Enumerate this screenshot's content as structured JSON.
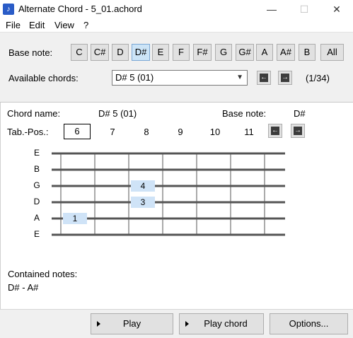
{
  "window": {
    "title": "Alternate Chord - 5_01.achord",
    "minimize": "—",
    "maximize": "☐",
    "close": "✕"
  },
  "menu": [
    "File",
    "Edit",
    "View",
    "?"
  ],
  "base_note": {
    "label": "Base note:",
    "notes": [
      "C",
      "C#",
      "D",
      "D#",
      "E",
      "F",
      "F#",
      "G",
      "G#",
      "A",
      "A#",
      "B"
    ],
    "all_label": "All",
    "selected": "D#"
  },
  "available": {
    "label": "Available chords:",
    "value": "D# 5 (01)",
    "counter": "(1/34)"
  },
  "chord": {
    "name_label": "Chord name:",
    "name_value": "D# 5 (01)",
    "base_label": "Base note:",
    "base_value": "D#",
    "tab_label": "Tab.-Pos.:",
    "positions": [
      "6",
      "7",
      "8",
      "9",
      "10",
      "11"
    ]
  },
  "strings": [
    "E",
    "B",
    "G",
    "D",
    "A",
    "E"
  ],
  "fingers": [
    {
      "string": 2,
      "fret": 3,
      "label": "4"
    },
    {
      "string": 3,
      "fret": 3,
      "label": "3"
    },
    {
      "string": 4,
      "fret": 1,
      "label": "1"
    }
  ],
  "contained": {
    "label": "Contained notes:",
    "value": "D# - A#"
  },
  "buttons": {
    "play": "Play",
    "play_chord": "Play chord",
    "options": "Options..."
  },
  "colors": {
    "selected_note_bg": "#cce4f7",
    "finger_bg": "#cfe3f7",
    "panel_bg": "#f0f0f0"
  }
}
